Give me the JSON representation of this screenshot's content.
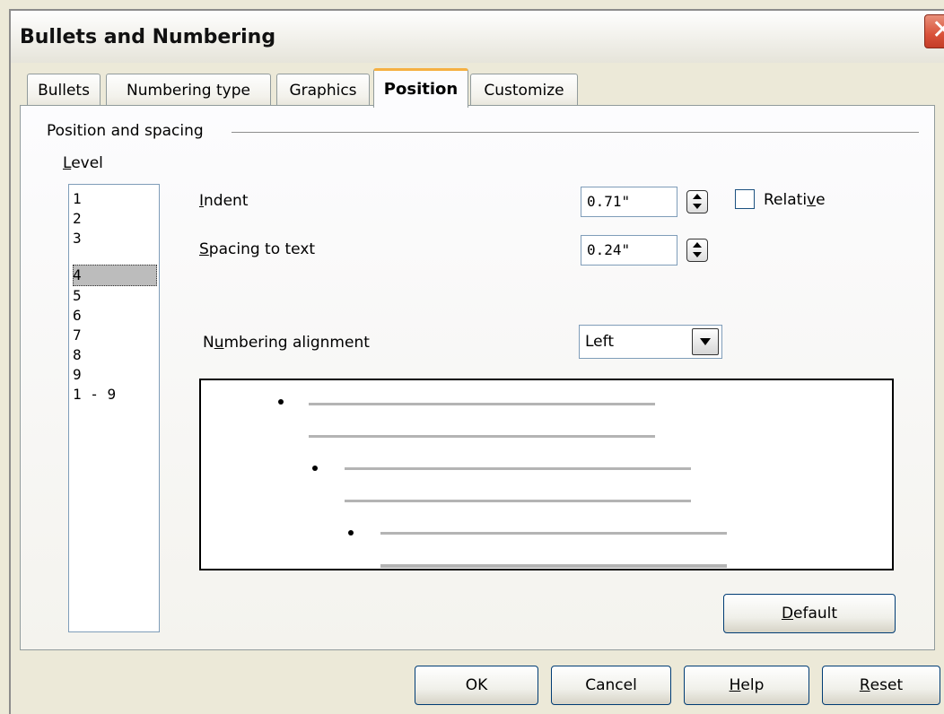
{
  "window": {
    "title": "Bullets and Numbering",
    "close_glyph": "✕"
  },
  "tabs": [
    {
      "label": "Bullets",
      "active": false
    },
    {
      "label": "Numbering type",
      "active": false
    },
    {
      "label": "Graphics",
      "active": false
    },
    {
      "label": "Position",
      "active": true
    },
    {
      "label": "Customize",
      "active": false
    }
  ],
  "group": {
    "label": "Position and spacing"
  },
  "level": {
    "label": "Level",
    "items": [
      "1",
      "2",
      "3",
      "4",
      "5",
      "6",
      "7",
      "8",
      "9",
      "1 - 9"
    ],
    "selected": "4"
  },
  "indent": {
    "label": "Indent",
    "value": "0.71\""
  },
  "relative": {
    "label": "Relative",
    "checked": false
  },
  "spacing": {
    "label": "Spacing to text",
    "value": "0.24\""
  },
  "alignment": {
    "label": "Numbering alignment",
    "value": "Left"
  },
  "buttons": {
    "default": "Default",
    "ok": "OK",
    "cancel": "Cancel",
    "help": "Help",
    "reset": "Reset"
  },
  "icons": {
    "close": "close-icon",
    "spin": "spin-updown-icon",
    "dropdown": "chevron-down-icon",
    "bullet": "bullet-icon"
  },
  "colors": {
    "close_red": "#d9523a",
    "active_tab_accent": "#f5b042",
    "dialog_bg": "#ece9d8"
  }
}
